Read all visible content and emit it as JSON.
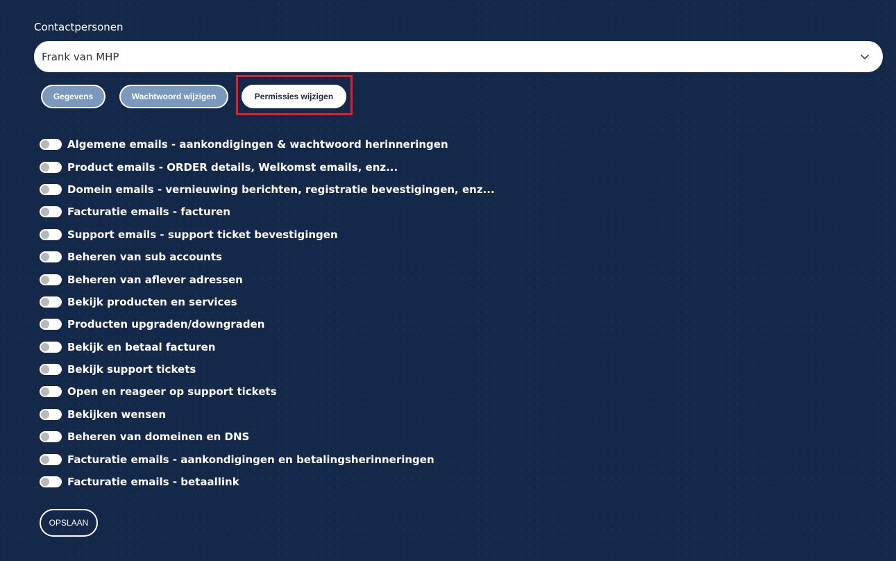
{
  "contacts": {
    "label": "Contactpersonen",
    "selected": "Frank van MHP"
  },
  "tabs": [
    {
      "label": "Gegevens",
      "active": false
    },
    {
      "label": "Wachtwoord wijzigen",
      "active": false
    },
    {
      "label": "Permissies wijzigen",
      "active": true
    }
  ],
  "permissions": [
    {
      "label": "Algemene emails - aankondigingen & wachtwoord herinneringen",
      "enabled": false
    },
    {
      "label": "Product emails - ORDER details, Welkomst emails, enz...",
      "enabled": false
    },
    {
      "label": "Domein emails - vernieuwing berichten, registratie bevestigingen, enz...",
      "enabled": false
    },
    {
      "label": "Facturatie emails - facturen",
      "enabled": false
    },
    {
      "label": "Support emails - support ticket bevestigingen",
      "enabled": false
    },
    {
      "label": "Beheren van sub accounts",
      "enabled": false
    },
    {
      "label": "Beheren van aflever adressen",
      "enabled": false
    },
    {
      "label": "Bekijk producten en services",
      "enabled": false
    },
    {
      "label": "Producten upgraden/downgraden",
      "enabled": false
    },
    {
      "label": "Bekijk en betaal facturen",
      "enabled": false
    },
    {
      "label": "Bekijk support tickets",
      "enabled": false
    },
    {
      "label": "Open en reageer op support tickets",
      "enabled": false
    },
    {
      "label": "Bekijken wensen",
      "enabled": false
    },
    {
      "label": "Beheren van domeinen en DNS",
      "enabled": false
    },
    {
      "label": "Facturatie emails - aankondigingen en betalingsherinneringen",
      "enabled": false
    },
    {
      "label": "Facturatie emails - betaallink",
      "enabled": false
    }
  ],
  "save_label": "OPSLAAN",
  "colors": {
    "background": "#14284a",
    "tab_inactive": "#7b99bd",
    "highlight": "#e0202a"
  },
  "icons": {
    "select_chevron": "chevron-down-icon"
  }
}
